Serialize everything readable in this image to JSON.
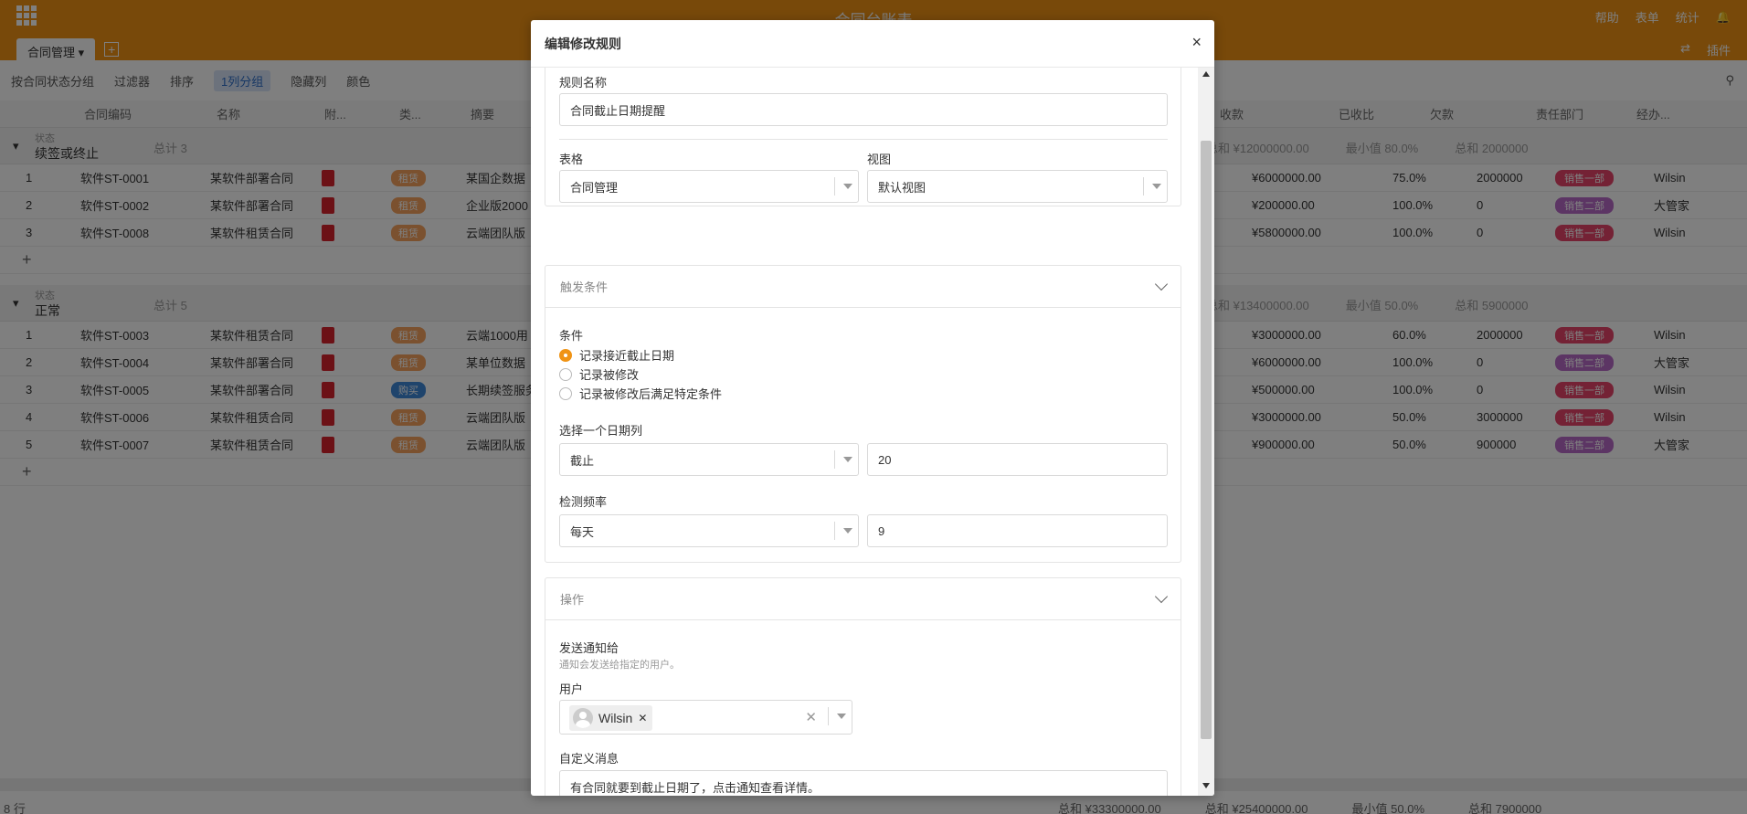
{
  "app": {
    "base_title": "合同台账表",
    "top_actions": [
      "帮助",
      "表单",
      "统计"
    ],
    "tab_label": "合同管理",
    "top_right_plugin": "插件"
  },
  "toolbar": {
    "group_by": "按合同状态分组",
    "filter": "过滤器",
    "sort": "排序",
    "grouped": "1列分组",
    "hidden": "隐藏列",
    "color": "颜色"
  },
  "grid": {
    "columns": [
      "合同编码",
      "名称",
      "附...",
      "类...",
      "摘要",
      "收款",
      "已收比",
      "欠款",
      "责任部门",
      "经办..."
    ],
    "group_label": "状态",
    "groups": [
      {
        "value": "续签或终止",
        "count": "总计 3",
        "stats": [
          "总和 ¥12000000.00",
          "最小值 80.0%",
          "总和 2000000"
        ],
        "rows": [
          {
            "no": "1",
            "code": "软件ST-0001",
            "name": "某软件部署合同",
            "type": "租赁",
            "summary": "某国企数据",
            "rec": "¥6000000.00",
            "pct": "75.0%",
            "owe": "2000000",
            "dept": "销售一部",
            "user": "Wilsin"
          },
          {
            "no": "2",
            "code": "软件ST-0002",
            "name": "某软件部署合同",
            "type": "租赁",
            "summary": "企业版2000",
            "rec": "¥200000.00",
            "pct": "100.0%",
            "owe": "0",
            "dept": "销售二部",
            "user": "大管家"
          },
          {
            "no": "3",
            "code": "软件ST-0008",
            "name": "某软件租赁合同",
            "type": "租赁",
            "summary": "云端团队版",
            "rec": "¥5800000.00",
            "pct": "100.0%",
            "owe": "0",
            "dept": "销售一部",
            "user": "Wilsin"
          }
        ]
      },
      {
        "value": "正常",
        "count": "总计 5",
        "stats": [
          "总和 ¥13400000.00",
          "最小值 50.0%",
          "总和 5900000"
        ],
        "rows": [
          {
            "no": "1",
            "code": "软件ST-0003",
            "name": "某软件租赁合同",
            "type": "租赁",
            "summary": "云端1000用",
            "rec": "¥3000000.00",
            "pct": "60.0%",
            "owe": "2000000",
            "dept": "销售一部",
            "user": "Wilsin"
          },
          {
            "no": "2",
            "code": "软件ST-0004",
            "name": "某软件部署合同",
            "type": "租赁",
            "summary": "某单位数据",
            "rec": "¥6000000.00",
            "pct": "100.0%",
            "owe": "0",
            "dept": "销售二部",
            "user": "大管家"
          },
          {
            "no": "3",
            "code": "软件ST-0005",
            "name": "某软件部署合同",
            "type": "购买",
            "summary": "长期续签服务",
            "rec": "¥500000.00",
            "pct": "100.0%",
            "owe": "0",
            "dept": "销售一部",
            "user": "Wilsin"
          },
          {
            "no": "4",
            "code": "软件ST-0006",
            "name": "某软件租赁合同",
            "type": "租赁",
            "summary": "云端团队版",
            "rec": "¥3000000.00",
            "pct": "50.0%",
            "owe": "3000000",
            "dept": "销售一部",
            "user": "Wilsin"
          },
          {
            "no": "5",
            "code": "软件ST-0007",
            "name": "某软件租赁合同",
            "type": "租赁",
            "summary": "云端团队版",
            "rec": "¥900000.00",
            "pct": "50.0%",
            "owe": "900000",
            "dept": "销售二部",
            "user": "大管家"
          }
        ]
      }
    ],
    "footer_rows": "8 行",
    "footer_stats": [
      "总和 ¥33300000.00",
      "总和 ¥25400000.00",
      "最小值 50.0%",
      "总和 7900000"
    ]
  },
  "dialog": {
    "title": "编辑修改规则",
    "close": "×",
    "rule_name_label": "规则名称",
    "rule_name_value": "合同截止日期提醒",
    "table_label": "表格",
    "table_value": "合同管理",
    "view_label": "视图",
    "view_value": "默认视图",
    "trigger_section": "触发条件",
    "condition_label": "条件",
    "conditions": [
      "记录接近截止日期",
      "记录被修改",
      "记录被修改后满足特定条件"
    ],
    "selected_condition": 0,
    "date_col_label": "选择一个日期列",
    "date_col_value": "截止",
    "date_days_value": "20",
    "freq_label": "检测频率",
    "freq_value": "每天",
    "freq_hour_value": "9",
    "action_section": "操作",
    "notify_label": "发送通知给",
    "notify_hint": "通知会发送给指定的用户。",
    "user_label": "用户",
    "user_chip": "Wilsin",
    "custom_msg_label": "自定义消息",
    "custom_msg_value": "有合同就要到截止日期了，点击通知查看详情。"
  },
  "colors": {
    "brand": "#f09315",
    "overlay": "rgba(0,0,0,0.5)"
  }
}
